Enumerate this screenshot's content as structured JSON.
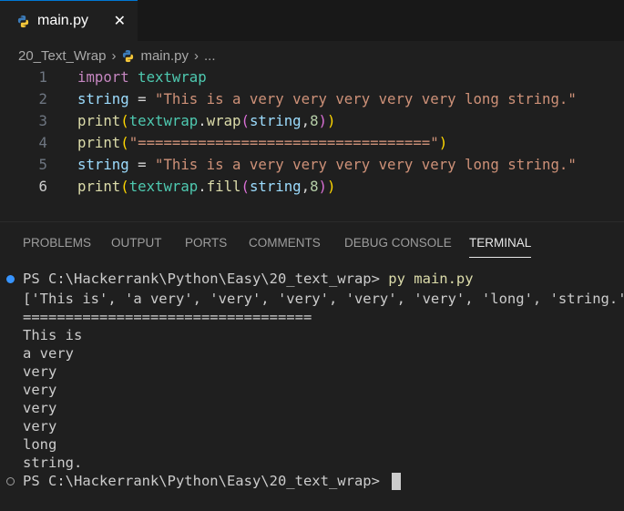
{
  "tab": {
    "label": "main.py",
    "close": "✕"
  },
  "breadcrumb": {
    "folder": "20_Text_Wrap",
    "file": "main.py",
    "more": "..."
  },
  "editor": {
    "lines": [
      {
        "num": "1",
        "tokens": [
          [
            "kw",
            "import"
          ],
          [
            "op",
            " "
          ],
          [
            "mod",
            "textwrap"
          ]
        ]
      },
      {
        "num": "2",
        "tokens": [
          [
            "var",
            "string"
          ],
          [
            "op",
            " = "
          ],
          [
            "str",
            "\"This is a very very very very very long string.\""
          ]
        ]
      },
      {
        "num": "3",
        "tokens": [
          [
            "fn",
            "print"
          ],
          [
            "p1",
            "("
          ],
          [
            "mod",
            "textwrap"
          ],
          [
            "op",
            "."
          ],
          [
            "fn",
            "wrap"
          ],
          [
            "p2",
            "("
          ],
          [
            "var",
            "string"
          ],
          [
            "op",
            ","
          ],
          [
            "num",
            "8"
          ],
          [
            "p2",
            ")"
          ],
          [
            "p1",
            ")"
          ]
        ]
      },
      {
        "num": "4",
        "tokens": [
          [
            "fn",
            "print"
          ],
          [
            "p1",
            "("
          ],
          [
            "str",
            "\"==================================\""
          ],
          [
            "p1",
            ")"
          ]
        ]
      },
      {
        "num": "5",
        "tokens": [
          [
            "var",
            "string"
          ],
          [
            "op",
            " = "
          ],
          [
            "str",
            "\"This is a very very very very very long string.\""
          ]
        ]
      },
      {
        "num": "6",
        "tokens": [
          [
            "fn",
            "print"
          ],
          [
            "p1",
            "("
          ],
          [
            "mod",
            "textwrap"
          ],
          [
            "op",
            "."
          ],
          [
            "fn",
            "fill"
          ],
          [
            "p2",
            "("
          ],
          [
            "var",
            "string"
          ],
          [
            "op",
            ","
          ],
          [
            "num",
            "8"
          ],
          [
            "p2",
            ")"
          ],
          [
            "p1",
            ")"
          ]
        ]
      }
    ],
    "active_line": "6"
  },
  "panel_tabs": [
    "PROBLEMS",
    "OUTPUT",
    "PORTS",
    "COMMENTS",
    "DEBUG CONSOLE",
    "TERMINAL"
  ],
  "active_panel": "TERMINAL",
  "terminal": {
    "prompt1": "PS C:\\Hackerrank\\Python\\Easy\\20_text_wrap> ",
    "command": "py main.py",
    "output": [
      "['This is', 'a very', 'very', 'very', 'very', 'very', 'long', 'string.']",
      "==================================",
      "This is",
      "a very",
      "very",
      "very",
      "very",
      "very",
      "long",
      "string."
    ],
    "prompt2": "PS C:\\Hackerrank\\Python\\Easy\\20_text_wrap> "
  },
  "colors": {
    "accent": "#0078d4",
    "dot": "#3794ff"
  },
  "icons": {
    "file": "python-icon",
    "close": "close-icon"
  }
}
